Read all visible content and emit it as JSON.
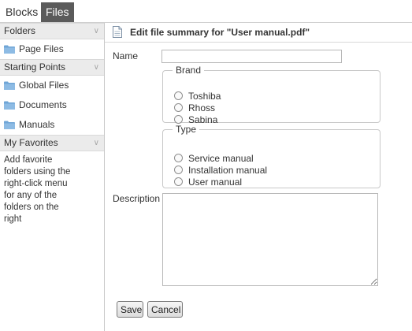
{
  "top_tabs": {
    "blocks": "Blocks",
    "files": "Files"
  },
  "sidebar": {
    "folders_header": "Folders",
    "folders": [
      "Page Files"
    ],
    "starting_points_header": "Starting Points",
    "starting_points": [
      "Global Files",
      "Documents",
      "Manuals"
    ],
    "favorites_header": "My Favorites",
    "favorites_help": "Add favorite folders using the right-click menu for any of the folders on the right"
  },
  "panel": {
    "title": "Edit file summary for \"User manual.pdf\"",
    "name_label": "Name",
    "name_value": "",
    "brand_legend": "Brand",
    "brand_options": [
      "Toshiba",
      "Rhoss",
      "Sabina"
    ],
    "type_legend": "Type",
    "type_options": [
      "Service manual",
      "Installation manual",
      "User manual"
    ],
    "description_label": "Description",
    "description_value": "",
    "save_label": "Save",
    "cancel_label": "Cancel"
  },
  "colors": {
    "active_tab_bg": "#5b5b5b",
    "section_header_bg": "#ebebeb",
    "folder_icon": "#6fa5d6"
  }
}
